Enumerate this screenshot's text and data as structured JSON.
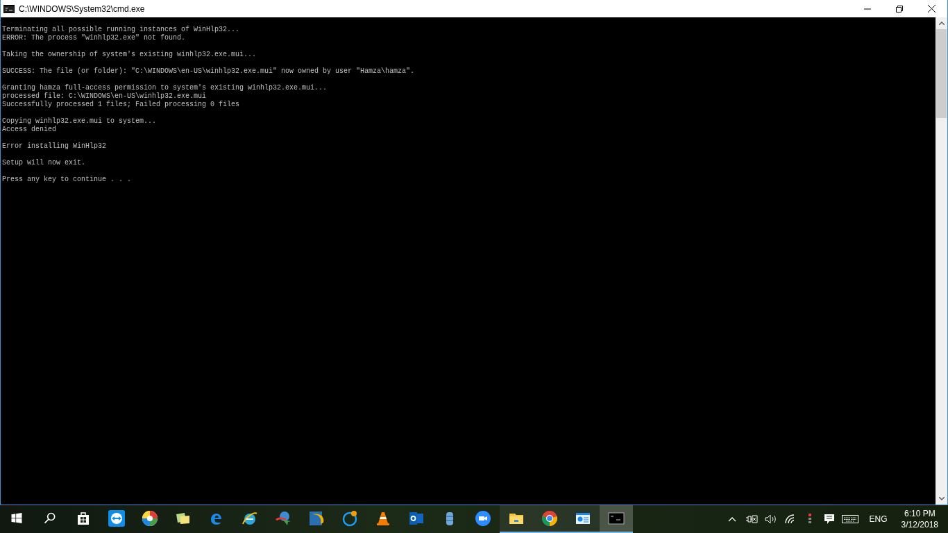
{
  "window": {
    "title": "C:\\WINDOWS\\System32\\cmd.exe"
  },
  "console": {
    "paragraphs": [
      [
        "Terminating all possible running instances of WinHlp32...",
        "ERROR: The process \"winhlp32.exe\" not found."
      ],
      [
        "Taking the ownership of system's existing winhlp32.exe.mui..."
      ],
      [
        "SUCCESS: The file (or folder): \"C:\\WINDOWS\\en-US\\winhlp32.exe.mui\" now owned by user \"Hamza\\hamza\"."
      ],
      [
        "Granting hamza full-access permission to system's existing winhlp32.exe.mui...",
        "processed file: C:\\WINDOWS\\en-US\\winhlp32.exe.mui",
        "Successfully processed 1 files; Failed processing 0 files"
      ],
      [
        "Copying winhlp32.exe.mui to system...",
        "Access denied"
      ],
      [
        "Error installing WinHlp32"
      ],
      [
        "Setup will now exit."
      ],
      [
        "Press any key to continue . . ."
      ]
    ]
  },
  "taskbar": {
    "apps": [
      {
        "running": false,
        "selected": false
      },
      {
        "running": false,
        "selected": false
      },
      {
        "running": false,
        "selected": false
      },
      {
        "running": false,
        "selected": false
      },
      {
        "running": false,
        "selected": false
      },
      {
        "running": false,
        "selected": false
      },
      {
        "running": false,
        "selected": false
      },
      {
        "running": false,
        "selected": false
      },
      {
        "running": false,
        "selected": false
      },
      {
        "running": false,
        "selected": false
      },
      {
        "running": false,
        "selected": false
      },
      {
        "running": false,
        "selected": false
      },
      {
        "running": false,
        "selected": false
      },
      {
        "running": false,
        "selected": false
      },
      {
        "running": false,
        "selected": false
      },
      {
        "running": true,
        "selected": false
      },
      {
        "running": true,
        "selected": false
      },
      {
        "running": true,
        "selected": false
      },
      {
        "running": true,
        "selected": true
      }
    ],
    "language": "ENG",
    "time": "6:10 PM",
    "date": "3/12/2018"
  }
}
